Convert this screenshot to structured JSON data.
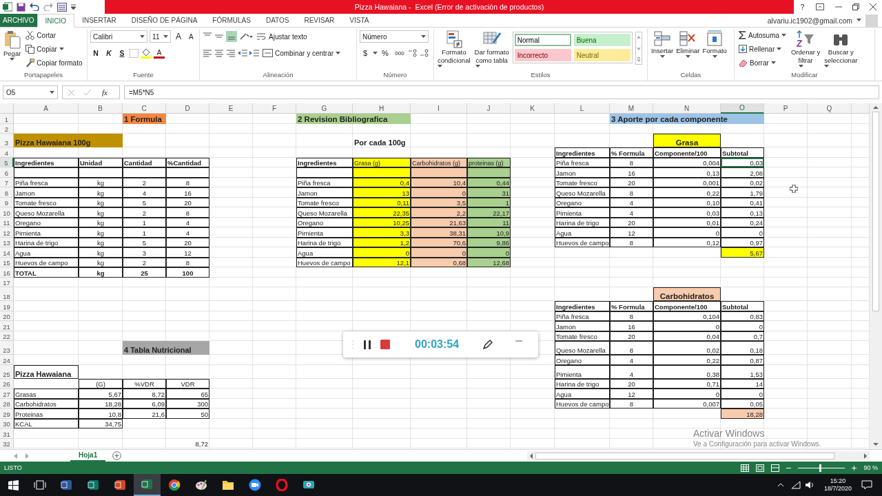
{
  "title_bar": {
    "title": "Pizza Hawaiana -  Excel (Error de activación de productos)",
    "help": "?"
  },
  "account": {
    "email": "alvariu.ic1902@gmail.com"
  },
  "tabs": [
    {
      "label": "ARCHIVO",
      "kind": "file",
      "selected": false
    },
    {
      "label": "INICIO",
      "kind": "tab",
      "selected": true
    },
    {
      "label": "INSERTAR",
      "kind": "tab",
      "selected": false
    },
    {
      "label": "DISEÑO DE PÁGINA",
      "kind": "tab",
      "selected": false
    },
    {
      "label": "FÓRMULAS",
      "kind": "tab",
      "selected": false
    },
    {
      "label": "DATOS",
      "kind": "tab",
      "selected": false
    },
    {
      "label": "REVISAR",
      "kind": "tab",
      "selected": false
    },
    {
      "label": "VISTA",
      "kind": "tab",
      "selected": false
    }
  ],
  "ribbon": {
    "clipboard": {
      "label": "Portapapeles",
      "paste": "Pegar",
      "cut": "Cortar",
      "copy": "Copiar",
      "format_painter": "Copiar formato"
    },
    "font": {
      "label": "Fuente",
      "family": "Calibri",
      "size": "11",
      "grow": "A",
      "shrink": "A",
      "bold": "N",
      "italic": "K",
      "underline": "S",
      "font_color": "A"
    },
    "alignment": {
      "label": "Alineación",
      "wrap": "Ajustar texto",
      "merge": "Combinar y centrar"
    },
    "number": {
      "label": "Número",
      "format": "Número",
      "currency": "$",
      "percent": "%",
      "thousands": "000"
    },
    "styles": {
      "label": "Estilos",
      "conditional": [
        "Formato",
        "condicional"
      ],
      "as_table": [
        "Dar formato",
        "como tabla"
      ],
      "cell_styles": [
        {
          "label": "Normal",
          "color": "#ffffff",
          "selected": true
        },
        {
          "label": "Buena",
          "color": "#c6efce",
          "selected": false
        },
        {
          "label": "Incorrecto",
          "color": "#ffc7ce",
          "selected": false
        },
        {
          "label": "Neutral",
          "color": "#ffeb9c",
          "selected": false
        }
      ]
    },
    "cells": {
      "label": "Celdas",
      "buttons": [
        {
          "label": "Insertar",
          "kind": "insert"
        },
        {
          "label": "Eliminar",
          "kind": "delete"
        },
        {
          "label": "Formato",
          "kind": "format"
        }
      ]
    },
    "editing": {
      "label": "Modificar",
      "autosum": "Autosuma",
      "fill": "Rellenar",
      "clear": "Borrar",
      "sort": [
        "Ordenar y",
        "filtrar"
      ],
      "find": [
        "Buscar y",
        "seleccionar"
      ]
    }
  },
  "formula_bar": {
    "name_box": "O5",
    "function_label": "fx",
    "formula": "=M5*N5"
  },
  "sheet": {
    "columns": [
      {
        "label": "A",
        "selected": false
      },
      {
        "label": "B",
        "selected": false
      },
      {
        "label": "C",
        "selected": false
      },
      {
        "label": "D",
        "selected": false
      },
      {
        "label": "E",
        "selected": false
      },
      {
        "label": "F",
        "selected": false
      },
      {
        "label": "G",
        "selected": false
      },
      {
        "label": "H",
        "selected": false
      },
      {
        "label": "I",
        "selected": false
      },
      {
        "label": "J",
        "selected": false
      },
      {
        "label": "K",
        "selected": false
      },
      {
        "label": "L",
        "selected": false
      },
      {
        "label": "M",
        "selected": false
      },
      {
        "label": "N",
        "selected": false
      },
      {
        "label": "O",
        "selected": true
      },
      {
        "label": "P",
        "selected": false
      },
      {
        "label": "Q",
        "selected": false
      }
    ],
    "rows": [
      {
        "number": "1",
        "selected": false,
        "cells": {
          "C": {
            "text": "1 Formula",
            "kind": "title",
            "bold": true,
            "bordered": false,
            "color": "#f4873f"
          },
          "G:H": {
            "text": "2 Revision Bibliografica",
            "kind": "title",
            "bold": true,
            "bordered": false,
            "color": "#a9d08e"
          },
          "M:O": {
            "text": "3 Aporte por cada componente",
            "kind": "title",
            "bold": true,
            "bordered": false,
            "color": "#9dc3e6"
          }
        }
      },
      {
        "number": "2",
        "selected": false
      },
      {
        "number": "3",
        "selected": false,
        "cells": {
          "A:B": {
            "text": "Pizza Hawaiana 100g",
            "kind": "heading",
            "bold": true,
            "bordered": false,
            "color": "#bf9000"
          },
          "H": {
            "text": "Por cada 100g",
            "kind": "heading",
            "bold": true,
            "bordered": false
          },
          "N": {
            "text": "Grasa",
            "kind": "heading-center",
            "bold": true,
            "bordered": true,
            "color": "#ffff00"
          }
        }
      },
      {
        "number": "4",
        "selected": false,
        "cells": {
          "L": {
            "text": "Ingredientes",
            "kind": "text",
            "bold": true,
            "bordered": true
          },
          "M": {
            "text": "% Formula",
            "kind": "text",
            "bold": true,
            "bordered": true
          },
          "N": {
            "text": "Componente/100",
            "kind": "text",
            "bold": true,
            "bordered": true
          },
          "O": {
            "text": "Subtotal",
            "kind": "text",
            "bold": true,
            "bordered": true
          }
        }
      },
      {
        "number": "5",
        "selected": true,
        "cells": {
          "A": {
            "text": "Ingredientes",
            "kind": "text",
            "bold": true,
            "bordered": true
          },
          "B": {
            "text": "Unidad",
            "kind": "text",
            "bold": true,
            "bordered": true
          },
          "C": {
            "text": "Cantidad",
            "kind": "text",
            "bold": true,
            "bordered": true
          },
          "D": {
            "text": "%Cantidad",
            "kind": "text",
            "bold": true,
            "bordered": true
          },
          "G": {
            "text": "Ingredientes",
            "kind": "text",
            "bold": true,
            "bordered": true
          },
          "H": {
            "text": "Grasa (g)",
            "kind": "small",
            "bold": false,
            "bordered": true,
            "color": "#ffff00"
          },
          "I": {
            "text": "Carbohidratos (g)",
            "kind": "small",
            "bold": false,
            "bordered": true,
            "color": "#f8cbad"
          },
          "J": {
            "text": "proteinas (g)",
            "kind": "small",
            "bold": false,
            "bordered": true,
            "color": "#a9d08e"
          },
          "L": {
            "text": "Piña fresca",
            "kind": "text",
            "bold": false,
            "bordered": true
          },
          "M": {
            "text": "8",
            "kind": "center",
            "bold": false,
            "bordered": true
          },
          "N": {
            "text": "0,004",
            "kind": "number",
            "bold": false,
            "bordered": true
          },
          "O": {
            "text": "0,03",
            "kind": "number",
            "bold": false,
            "bordered": true
          }
        }
      },
      {
        "number": "6",
        "selected": false,
        "cells": {
          "A": {
            "kind": "text",
            "bold": false,
            "bordered": true
          },
          "B": {
            "kind": "text",
            "bold": false,
            "bordered": true
          },
          "C": {
            "kind": "text",
            "bold": false,
            "bordered": true
          },
          "D": {
            "kind": "text",
            "bold": false,
            "bordered": true
          },
          "G": {
            "kind": "text",
            "bold": false,
            "bordered": true
          },
          "H": {
            "kind": "text",
            "bold": false,
            "bordered": true,
            "color": "#ffff00"
          },
          "I": {
            "kind": "text",
            "bold": false,
            "bordered": true,
            "color": "#f8cbad"
          },
          "J": {
            "kind": "text",
            "bold": false,
            "bordered": true,
            "color": "#a9d08e"
          },
          "L": {
            "text": "Jamon",
            "kind": "text",
            "bold": false,
            "bordered": true
          },
          "M": {
            "text": "16",
            "kind": "center",
            "bold": false,
            "bordered": true
          },
          "N": {
            "text": "0,13",
            "kind": "number",
            "bold": false,
            "bordered": true
          },
          "O": {
            "text": "2,08",
            "kind": "number",
            "bold": false,
            "bordered": true
          }
        }
      },
      {
        "number": "7",
        "selected": false,
        "cells": {
          "A": {
            "text": "Piña fresca",
            "kind": "text",
            "bold": false,
            "bordered": true
          },
          "B": {
            "text": "kg",
            "kind": "center",
            "bold": false,
            "bordered": true
          },
          "C": {
            "text": "2",
            "kind": "center",
            "bold": false,
            "bordered": true
          },
          "D": {
            "text": "8",
            "kind": "center",
            "bold": false,
            "bordered": true
          },
          "G": {
            "text": "Piña fresca",
            "kind": "text",
            "bold": false,
            "bordered": true
          },
          "H": {
            "text": "0,4",
            "kind": "number",
            "bold": false,
            "bordered": true,
            "color": "#ffff00"
          },
          "I": {
            "text": "10,4",
            "kind": "number",
            "bold": false,
            "bordered": true,
            "color": "#f8cbad"
          },
          "J": {
            "text": "0,44",
            "kind": "number",
            "bold": false,
            "bordered": true,
            "color": "#a9d08e"
          },
          "L": {
            "text": "Tomate fresco",
            "kind": "text",
            "bold": false,
            "bordered": true
          },
          "M": {
            "text": "20",
            "kind": "center",
            "bold": false,
            "bordered": true
          },
          "N": {
            "text": "0,001",
            "kind": "number",
            "bold": false,
            "bordered": true
          },
          "O": {
            "text": "0,02",
            "kind": "number",
            "bold": false,
            "bordered": true
          }
        }
      },
      {
        "number": "8",
        "selected": false,
        "cells": {
          "A": {
            "text": "Jamon",
            "kind": "text",
            "bold": false,
            "bordered": true
          },
          "B": {
            "text": "kg",
            "kind": "center",
            "bold": false,
            "bordered": true
          },
          "C": {
            "text": "4",
            "kind": "center",
            "bold": false,
            "bordered": true
          },
          "D": {
            "text": "16",
            "kind": "center",
            "bold": false,
            "bordered": true
          },
          "G": {
            "text": "Jamon",
            "kind": "text",
            "bold": false,
            "bordered": true
          },
          "H": {
            "text": "13",
            "kind": "number",
            "bold": false,
            "bordered": true,
            "color": "#ffff00"
          },
          "I": {
            "text": "0",
            "kind": "number",
            "bold": false,
            "bordered": true,
            "color": "#f8cbad"
          },
          "J": {
            "text": "31",
            "kind": "number",
            "bold": false,
            "bordered": true,
            "color": "#a9d08e"
          },
          "L": {
            "text": "Queso Mozarella",
            "kind": "text",
            "bold": false,
            "bordered": true
          },
          "M": {
            "text": "8",
            "kind": "center",
            "bold": false,
            "bordered": true
          },
          "N": {
            "text": "0,22",
            "kind": "number",
            "bold": false,
            "bordered": true
          },
          "O": {
            "text": "1,79",
            "kind": "number",
            "bold": false,
            "bordered": true
          }
        }
      },
      {
        "number": "9",
        "selected": false,
        "cells": {
          "A": {
            "text": "Tomate fresco",
            "kind": "text",
            "bold": false,
            "bordered": true
          },
          "B": {
            "text": "kg",
            "kind": "center",
            "bold": false,
            "bordered": true
          },
          "C": {
            "text": "5",
            "kind": "center",
            "bold": false,
            "bordered": true
          },
          "D": {
            "text": "20",
            "kind": "center",
            "bold": false,
            "bordered": true
          },
          "G": {
            "text": "Tomate fresco",
            "kind": "text",
            "bold": false,
            "bordered": true
          },
          "H": {
            "text": "0,11",
            "kind": "number",
            "bold": false,
            "bordered": true,
            "color": "#ffff00"
          },
          "I": {
            "text": "3,5",
            "kind": "number",
            "bold": false,
            "bordered": true,
            "color": "#f8cbad"
          },
          "J": {
            "text": "1",
            "kind": "number",
            "bold": false,
            "bordered": true,
            "color": "#a9d08e"
          },
          "L": {
            "text": "Oregano",
            "kind": "text",
            "bold": false,
            "bordered": true
          },
          "M": {
            "text": "4",
            "kind": "center",
            "bold": false,
            "bordered": true
          },
          "N": {
            "text": "0,10",
            "kind": "number",
            "bold": false,
            "bordered": true
          },
          "O": {
            "text": "0,41",
            "kind": "number",
            "bold": false,
            "bordered": true
          }
        }
      },
      {
        "number": "10",
        "selected": false,
        "cells": {
          "A": {
            "text": "Queso Mozarella",
            "kind": "text",
            "bold": false,
            "bordered": true
          },
          "B": {
            "text": "kg",
            "kind": "center",
            "bold": false,
            "bordered": true
          },
          "C": {
            "text": "2",
            "kind": "center",
            "bold": false,
            "bordered": true
          },
          "D": {
            "text": "8",
            "kind": "center",
            "bold": false,
            "bordered": true
          },
          "G": {
            "text": "Queso Mozarella",
            "kind": "text",
            "bold": false,
            "bordered": true
          },
          "H": {
            "text": "22,35",
            "kind": "number",
            "bold": false,
            "bordered": true,
            "color": "#ffff00"
          },
          "I": {
            "text": "2,2",
            "kind": "number",
            "bold": false,
            "bordered": true,
            "color": "#f8cbad"
          },
          "J": {
            "text": "22,17",
            "kind": "number",
            "bold": false,
            "bordered": true,
            "color": "#a9d08e"
          },
          "L": {
            "text": "Pimienta",
            "kind": "text",
            "bold": false,
            "bordered": true
          },
          "M": {
            "text": "4",
            "kind": "center",
            "bold": false,
            "bordered": true
          },
          "N": {
            "text": "0,03",
            "kind": "number",
            "bold": false,
            "bordered": true
          },
          "O": {
            "text": "0,13",
            "kind": "number",
            "bold": false,
            "bordered": true
          }
        }
      },
      {
        "number": "11",
        "selected": false,
        "cells": {
          "A": {
            "text": "Oregano",
            "kind": "text",
            "bold": false,
            "bordered": true
          },
          "B": {
            "text": "kg",
            "kind": "center",
            "bold": false,
            "bordered": true
          },
          "C": {
            "text": "1",
            "kind": "center",
            "bold": false,
            "bordered": true
          },
          "D": {
            "text": "4",
            "kind": "center",
            "bold": false,
            "bordered": true
          },
          "G": {
            "text": "Oregano",
            "kind": "text",
            "bold": false,
            "bordered": true
          },
          "H": {
            "text": "10,25",
            "kind": "number",
            "bold": false,
            "bordered": true,
            "color": "#ffff00"
          },
          "I": {
            "text": "21,63",
            "kind": "number",
            "bold": false,
            "bordered": true,
            "color": "#f8cbad"
          },
          "J": {
            "text": "11",
            "kind": "number",
            "bold": false,
            "bordered": true,
            "color": "#a9d08e"
          },
          "L": {
            "text": "Harina de trigo",
            "kind": "text",
            "bold": false,
            "bordered": true
          },
          "M": {
            "text": "20",
            "kind": "center",
            "bold": false,
            "bordered": true
          },
          "N": {
            "text": "0,01",
            "kind": "number",
            "bold": false,
            "bordered": true
          },
          "O": {
            "text": "0,24",
            "kind": "number",
            "bold": false,
            "bordered": true
          }
        }
      },
      {
        "number": "12",
        "selected": false,
        "cells": {
          "A": {
            "text": "Pimienta",
            "kind": "text",
            "bold": false,
            "bordered": true
          },
          "B": {
            "text": "kg",
            "kind": "center",
            "bold": false,
            "bordered": true
          },
          "C": {
            "text": "1",
            "kind": "center",
            "bold": false,
            "bordered": true
          },
          "D": {
            "text": "4",
            "kind": "center",
            "bold": false,
            "bordered": true
          },
          "G": {
            "text": "Pimienta",
            "kind": "text",
            "bold": false,
            "bordered": true
          },
          "H": {
            "text": "3,3",
            "kind": "number",
            "bold": false,
            "bordered": true,
            "color": "#ffff00"
          },
          "I": {
            "text": "38,31",
            "kind": "number",
            "bold": false,
            "bordered": true,
            "color": "#f8cbad"
          },
          "J": {
            "text": "10,9",
            "kind": "number",
            "bold": false,
            "bordered": true,
            "color": "#a9d08e"
          },
          "L": {
            "text": "Agua",
            "kind": "text",
            "bold": false,
            "bordered": true
          },
          "M": {
            "text": "12",
            "kind": "center",
            "bold": false,
            "bordered": true
          },
          "N": {
            "text": "0",
            "kind": "number",
            "bold": false,
            "bordered": true
          },
          "O": {
            "text": "0",
            "kind": "number",
            "bold": false,
            "bordered": true
          }
        }
      },
      {
        "number": "13",
        "selected": false,
        "cells": {
          "A": {
            "text": "Harina de trigo",
            "kind": "text",
            "bold": false,
            "bordered": true
          },
          "B": {
            "text": "kg",
            "kind": "center",
            "bold": false,
            "bordered": true
          },
          "C": {
            "text": "5",
            "kind": "center",
            "bold": false,
            "bordered": true
          },
          "D": {
            "text": "20",
            "kind": "center",
            "bold": false,
            "bordered": true
          },
          "G": {
            "text": "Harina de trigo",
            "kind": "text",
            "bold": false,
            "bordered": true
          },
          "H": {
            "text": "1,2",
            "kind": "number",
            "bold": false,
            "bordered": true,
            "color": "#ffff00"
          },
          "I": {
            "text": "70,6",
            "kind": "number",
            "bold": false,
            "bordered": true,
            "color": "#f8cbad"
          },
          "J": {
            "text": "9,86",
            "kind": "number",
            "bold": false,
            "bordered": true,
            "color": "#a9d08e"
          },
          "L": {
            "text": "Huevos de campo",
            "kind": "text",
            "bold": false,
            "bordered": true
          },
          "M": {
            "text": "8",
            "kind": "center",
            "bold": false,
            "bordered": true
          },
          "N": {
            "text": "0,12",
            "kind": "number",
            "bold": false,
            "bordered": true
          },
          "O": {
            "text": "0,97",
            "kind": "number",
            "bold": false,
            "bordered": true
          }
        }
      },
      {
        "number": "14",
        "selected": false,
        "cells": {
          "A": {
            "text": "Agua",
            "kind": "text",
            "bold": false,
            "bordered": true
          },
          "B": {
            "text": "kg",
            "kind": "center",
            "bold": false,
            "bordered": true
          },
          "C": {
            "text": "3",
            "kind": "center",
            "bold": false,
            "bordered": true
          },
          "D": {
            "text": "12",
            "kind": "center",
            "bold": false,
            "bordered": true
          },
          "G": {
            "text": "Agua",
            "kind": "text",
            "bold": false,
            "bordered": true
          },
          "H": {
            "text": "0",
            "kind": "number",
            "bold": false,
            "bordered": true,
            "color": "#ffff00"
          },
          "I": {
            "text": "0",
            "kind": "number",
            "bold": false,
            "bordered": true,
            "color": "#f8cbad"
          },
          "J": {
            "text": "0",
            "kind": "number",
            "bold": false,
            "bordered": true,
            "color": "#a9d08e"
          },
          "O": {
            "text": "5,67",
            "kind": "number",
            "bold": false,
            "bordered": true,
            "color": "#ffff00"
          }
        }
      },
      {
        "number": "15",
        "selected": false,
        "cells": {
          "A": {
            "text": "Huevos de campo",
            "kind": "text",
            "bold": false,
            "bordered": true
          },
          "B": {
            "text": "kg",
            "kind": "center",
            "bold": false,
            "bordered": true
          },
          "C": {
            "text": "2",
            "kind": "center",
            "bold": false,
            "bordered": true
          },
          "D": {
            "text": "8",
            "kind": "center",
            "bold": false,
            "bordered": true
          },
          "G": {
            "text": "Huevos de campo",
            "kind": "text",
            "bold": false,
            "bordered": true
          },
          "H": {
            "text": "12,1",
            "kind": "number",
            "bold": false,
            "bordered": true,
            "color": "#ffff00"
          },
          "I": {
            "text": "0,68",
            "kind": "number",
            "bold": false,
            "bordered": true,
            "color": "#f8cbad"
          },
          "J": {
            "text": "12,68",
            "kind": "number",
            "bold": false,
            "bordered": true,
            "color": "#a9d08e"
          }
        }
      },
      {
        "number": "16",
        "selected": false,
        "cells": {
          "A": {
            "text": "TOTAL",
            "kind": "text",
            "bold": true,
            "bordered": true
          },
          "B": {
            "text": "kg",
            "kind": "center",
            "bold": true,
            "bordered": true
          },
          "C": {
            "text": "25",
            "kind": "center",
            "bold": true,
            "bordered": true
          },
          "D": {
            "text": "100",
            "kind": "center",
            "bold": true,
            "bordered": true
          }
        }
      },
      {
        "number": "17",
        "selected": false
      },
      {
        "number": "18",
        "selected": false,
        "cells": {
          "N": {
            "text": "Carbohidratos",
            "kind": "heading-center",
            "bold": true,
            "bordered": true,
            "color": "#f8cbad"
          }
        }
      },
      {
        "number": "19",
        "selected": false,
        "cells": {
          "L": {
            "text": "Ingredientes",
            "kind": "text",
            "bold": true,
            "bordered": true
          },
          "M": {
            "text": "% Formula",
            "kind": "text",
            "bold": true,
            "bordered": true
          },
          "N": {
            "text": "Componente/100",
            "kind": "text",
            "bold": true,
            "bordered": true
          },
          "O": {
            "text": "Subtotal",
            "kind": "text",
            "bold": true,
            "bordered": true
          }
        }
      },
      {
        "number": "20",
        "selected": false,
        "cells": {
          "L": {
            "text": "Piña fresca",
            "kind": "text",
            "bold": false,
            "bordered": true
          },
          "M": {
            "text": "8",
            "kind": "center",
            "bold": false,
            "bordered": true
          },
          "N": {
            "text": "0,104",
            "kind": "number",
            "bold": false,
            "bordered": true
          },
          "O": {
            "text": "0,83",
            "kind": "number",
            "bold": false,
            "bordered": true
          }
        }
      },
      {
        "number": "21",
        "selected": false,
        "cells": {
          "L": {
            "text": "Jamon",
            "kind": "text",
            "bold": false,
            "bordered": true
          },
          "M": {
            "text": "16",
            "kind": "center",
            "bold": false,
            "bordered": true
          },
          "N": {
            "text": "0",
            "kind": "number",
            "bold": false,
            "bordered": true
          },
          "O": {
            "text": "0",
            "kind": "number",
            "bold": false,
            "bordered": true
          }
        }
      },
      {
        "number": "22",
        "selected": false,
        "cells": {
          "L": {
            "text": "Tomate fresco",
            "kind": "text",
            "bold": false,
            "bordered": true
          },
          "M": {
            "text": "20",
            "kind": "center",
            "bold": false,
            "bordered": true
          },
          "N": {
            "text": "0,04",
            "kind": "number",
            "bold": false,
            "bordered": true
          },
          "O": {
            "text": "0,7",
            "kind": "number",
            "bold": false,
            "bordered": true
          }
        }
      },
      {
        "number": "23",
        "selected": false,
        "cells": {
          "C:D": {
            "text": "4 Tabla Nutricional",
            "kind": "heading",
            "bold": true,
            "bordered": false,
            "color": "#a6a6a6"
          },
          "L": {
            "text": "Queso Mozarella",
            "kind": "text",
            "bold": false,
            "bordered": true
          },
          "M": {
            "text": "8",
            "kind": "center",
            "bold": false,
            "bordered": true
          },
          "N": {
            "text": "0,02",
            "kind": "number",
            "bold": false,
            "bordered": true
          },
          "O": {
            "text": "0,18",
            "kind": "number",
            "bold": false,
            "bordered": true
          }
        }
      },
      {
        "number": "24",
        "selected": false,
        "cells": {
          "L": {
            "text": "Oregano",
            "kind": "text",
            "bold": false,
            "bordered": true
          },
          "M": {
            "text": "4",
            "kind": "center",
            "bold": false,
            "bordered": true
          },
          "N": {
            "text": "0,22",
            "kind": "number",
            "bold": false,
            "bordered": true
          },
          "O": {
            "text": "0,87",
            "kind": "number",
            "bold": false,
            "bordered": true
          }
        }
      },
      {
        "number": "25",
        "selected": false,
        "cells": {
          "A": {
            "text": "Pizza Hawaiana",
            "kind": "heading",
            "bold": true,
            "bordered": true
          },
          "L": {
            "text": "Pimienta",
            "kind": "text",
            "bold": false,
            "bordered": true
          },
          "M": {
            "text": "4",
            "kind": "center",
            "bold": false,
            "bordered": true
          },
          "N": {
            "text": "0,38",
            "kind": "number",
            "bold": false,
            "bordered": true
          },
          "O": {
            "text": "1,53",
            "kind": "number",
            "bold": false,
            "bordered": true
          }
        }
      },
      {
        "number": "26",
        "selected": false,
        "cells": {
          "B": {
            "text": "(G)",
            "kind": "center",
            "bold": false,
            "bordered": true
          },
          "C": {
            "text": "%VDR",
            "kind": "center",
            "bold": false,
            "bordered": true
          },
          "D": {
            "text": "VDR",
            "kind": "center",
            "bold": false,
            "bordered": true
          },
          "L": {
            "text": "Harina de trigo",
            "kind": "text",
            "bold": false,
            "bordered": true
          },
          "M": {
            "text": "20",
            "kind": "center",
            "bold": false,
            "bordered": true
          },
          "N": {
            "text": "0,71",
            "kind": "number",
            "bold": false,
            "bordered": true
          },
          "O": {
            "text": "14",
            "kind": "number",
            "bold": false,
            "bordered": true
          }
        }
      },
      {
        "number": "27",
        "selected": false,
        "cells": {
          "A": {
            "text": "Grasas",
            "kind": "text",
            "bold": false,
            "bordered": true
          },
          "B": {
            "text": "5,67",
            "kind": "number",
            "bold": false,
            "bordered": true
          },
          "C": {
            "text": "8,72",
            "kind": "number",
            "bold": false,
            "bordered": true
          },
          "D": {
            "text": "65",
            "kind": "number",
            "bold": false,
            "bordered": true
          },
          "L": {
            "text": "Agua",
            "kind": "text",
            "bold": false,
            "bordered": true
          },
          "M": {
            "text": "12",
            "kind": "center",
            "bold": false,
            "bordered": true
          },
          "N": {
            "text": "0",
            "kind": "number",
            "bold": false,
            "bordered": true
          },
          "O": {
            "text": "0",
            "kind": "number",
            "bold": false,
            "bordered": true
          }
        }
      },
      {
        "number": "28",
        "selected": false,
        "cells": {
          "A": {
            "text": "Carbohidratos",
            "kind": "text",
            "bold": false,
            "bordered": true
          },
          "B": {
            "text": "18,28",
            "kind": "number",
            "bold": false,
            "bordered": true
          },
          "C": {
            "text": "6,09",
            "kind": "number",
            "bold": false,
            "bordered": true
          },
          "D": {
            "text": "300",
            "kind": "number",
            "bold": false,
            "bordered": true
          },
          "L": {
            "text": "Huevos de campo",
            "kind": "text",
            "bold": false,
            "bordered": true
          },
          "M": {
            "text": "8",
            "kind": "center",
            "bold": false,
            "bordered": true
          },
          "N": {
            "text": "0,007",
            "kind": "number",
            "bold": false,
            "bordered": true
          },
          "O": {
            "text": "0,05",
            "kind": "number",
            "bold": false,
            "bordered": true
          }
        }
      },
      {
        "number": "29",
        "selected": false,
        "cells": {
          "A": {
            "text": "Proteinas",
            "kind": "text",
            "bold": false,
            "bordered": true
          },
          "B": {
            "text": "10,8",
            "kind": "number",
            "bold": false,
            "bordered": true
          },
          "C": {
            "text": "21,6",
            "kind": "number",
            "bold": false,
            "bordered": true
          },
          "D": {
            "text": "50",
            "kind": "number",
            "bold": false,
            "bordered": true
          },
          "O": {
            "text": "18,28",
            "kind": "number",
            "bold": false,
            "bordered": true,
            "color": "#f8cbad"
          }
        }
      },
      {
        "number": "30",
        "selected": false,
        "cells": {
          "A": {
            "text": "KCAL",
            "kind": "text",
            "bold": false,
            "bordered": true
          },
          "B": {
            "text": "34,75",
            "kind": "number",
            "bold": false,
            "bordered": true
          }
        }
      },
      {
        "number": "31",
        "selected": false
      },
      {
        "number": "32",
        "selected": false,
        "cells": {
          "D": {
            "text": "8,72",
            "kind": "number",
            "bold": false,
            "bordered": false
          }
        }
      }
    ]
  },
  "sheet_tabs": [
    {
      "label": "Hoja1",
      "selected": true
    }
  ],
  "status_bar": {
    "mode": "LISTO",
    "zoom": "90 %",
    "zoom_slider": {
      "level": 0.45
    }
  },
  "taskbar": {
    "apps": [
      {
        "kind": "word",
        "selected": false
      },
      {
        "kind": "publisher",
        "selected": false
      },
      {
        "kind": "powerpoint",
        "selected": false
      },
      {
        "kind": "excel",
        "selected": true
      },
      {
        "kind": "chrome",
        "selected": false
      },
      {
        "kind": "paint",
        "selected": false
      },
      {
        "kind": "folder",
        "selected": false
      },
      {
        "kind": "zoom",
        "selected": false
      },
      {
        "kind": "opera",
        "selected": false
      },
      {
        "kind": "camera",
        "selected": false
      }
    ],
    "time": "15:20",
    "date": "18/7/2020"
  },
  "recorder": {
    "time": "00:03:54"
  },
  "activation": {
    "title": "Activar Windows",
    "message": "Ve a Configuración para activar Windows."
  }
}
